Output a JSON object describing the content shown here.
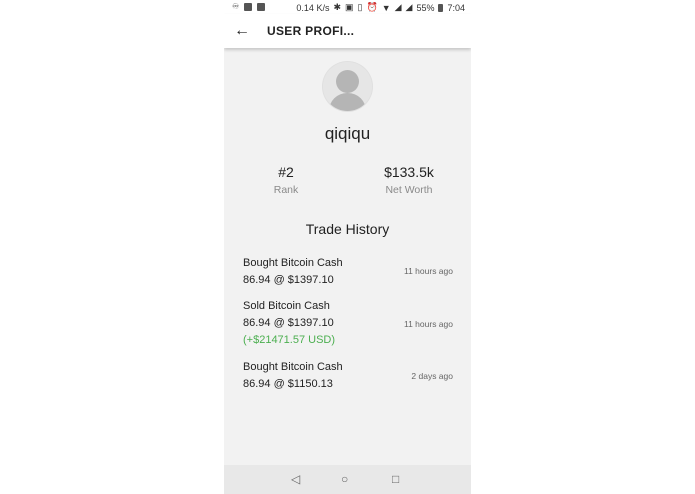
{
  "status_bar": {
    "speed": "0.14 K/s",
    "battery": "55%",
    "time": "7:04"
  },
  "appbar": {
    "title": "USER PROFI..."
  },
  "profile": {
    "username": "qiqiqu",
    "rank_value": "#2",
    "rank_label": "Rank",
    "networth_value": "$133.5k",
    "networth_label": "Net Worth"
  },
  "trade_history": {
    "title": "Trade History",
    "trades": [
      {
        "action": "Bought Bitcoin Cash",
        "detail": "86.94 @ $1397.10",
        "time": "11 hours ago"
      },
      {
        "action": "Sold Bitcoin Cash",
        "detail": "86.94 @ $1397.10",
        "profit": "(+$21471.57 USD)",
        "time": "11 hours ago"
      },
      {
        "action": "Bought Bitcoin Cash",
        "detail": "86.94 @ $1150.13",
        "time": "2 days ago"
      }
    ]
  },
  "icons": {
    "back": "arrow-left",
    "nav_back": "triangle-left",
    "nav_home": "circle",
    "nav_recents": "square"
  },
  "colors": {
    "profit": "#4caf50"
  }
}
